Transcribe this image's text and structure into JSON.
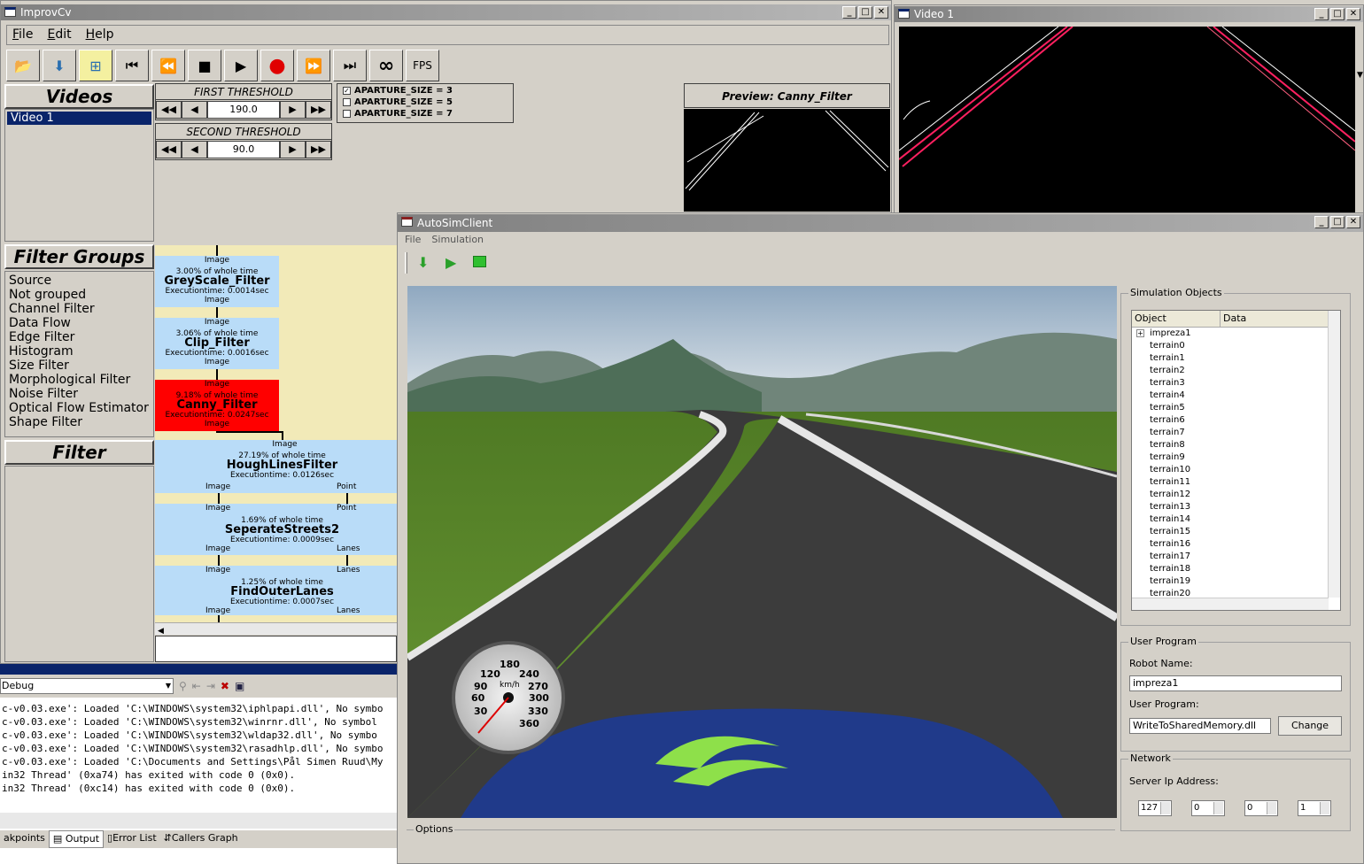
{
  "improvcv": {
    "title": "ImprovCv",
    "menu": [
      "File",
      "Edit",
      "Help"
    ],
    "fps": "FPS"
  },
  "videos": {
    "header": "Videos",
    "items": [
      "Video 1"
    ]
  },
  "filter_groups": {
    "header": "Filter Groups",
    "items": [
      "Source",
      "Not grouped",
      "Channel Filter",
      "Data Flow",
      "Edge Filter",
      "Histogram",
      "Size Filter",
      "Morphological Filter",
      "Noise Filter",
      "Optical Flow Estimator",
      "Shape Filter"
    ]
  },
  "filter": {
    "header": "Filter"
  },
  "thresholds": [
    {
      "title": "FIRST THRESHOLD",
      "value": "190.0"
    },
    {
      "title": "SECOND THRESHOLD",
      "value": "90.0"
    }
  ],
  "aperture": [
    {
      "label": "APARTURE_SIZE = 3",
      "checked": "✓"
    },
    {
      "label": "APARTURE_SIZE = 5",
      "checked": ""
    },
    {
      "label": "APARTURE_SIZE = 7",
      "checked": ""
    }
  ],
  "preview": {
    "title": "Preview: Canny_Filter"
  },
  "filters": [
    {
      "name": "GreyScale_Filter",
      "pct": "3.00% of whole time",
      "exec": "Executiontime: 0.0014sec",
      "in": "Image",
      "out": "Image"
    },
    {
      "name": "Clip_Filter",
      "pct": "3.06% of whole time",
      "exec": "Executiontime: 0.0016sec",
      "in": "Image",
      "out": "Image"
    },
    {
      "name": "Canny_Filter",
      "pct": "9.18% of whole time",
      "exec": "Executiontime: 0.0247sec",
      "in": "Image",
      "out": "Image"
    },
    {
      "name": "HoughLinesFilter",
      "pct": "27.19% of whole time",
      "exec": "Executiontime: 0.0126sec",
      "in": "Image",
      "out": "Image",
      "out2": "Point"
    },
    {
      "name": "SeperateStreets2",
      "pct": "1.69% of whole time",
      "exec": "Executiontime: 0.0009sec",
      "in": "Image",
      "in2": "Point",
      "out": "Image",
      "out2": "Lanes"
    },
    {
      "name": "FindOuterLanes",
      "pct": "1.25% of whole time",
      "exec": "Executiontime: 0.0007sec",
      "in": "Image",
      "in2": "Lanes",
      "out": "Image",
      "out2": "Lanes"
    }
  ],
  "video1": {
    "title": "Video 1"
  },
  "output": {
    "config": "Debug",
    "lines": [
      "c-v0.03.exe': Loaded 'C:\\WINDOWS\\system32\\iphlpapi.dll', No symbo",
      "c-v0.03.exe': Loaded 'C:\\WINDOWS\\system32\\winrnr.dll', No symbol",
      "c-v0.03.exe': Loaded 'C:\\WINDOWS\\system32\\wldap32.dll', No symbo",
      "c-v0.03.exe': Loaded 'C:\\WINDOWS\\system32\\rasadhlp.dll', No symbo",
      "c-v0.03.exe': Loaded 'C:\\Documents and Settings\\Pål Simen Ruud\\My",
      "in32 Thread' (0xa74) has exited with code 0 (0x0).",
      "in32 Thread' (0xc14) has exited with code 0 (0x0)."
    ],
    "tabs": [
      "akpoints",
      "Output",
      "Error List",
      "Callers Graph"
    ]
  },
  "autosim": {
    "title": "AutoSimClient",
    "menu": [
      "File",
      "Simulation"
    ],
    "options": "Options",
    "sim_objects": {
      "title": "Simulation Objects",
      "col1": "Object",
      "col2": "Data",
      "items": [
        "impreza1",
        "terrain0",
        "terrain1",
        "terrain2",
        "terrain3",
        "terrain4",
        "terrain5",
        "terrain6",
        "terrain7",
        "terrain8",
        "terrain9",
        "terrain10",
        "terrain11",
        "terrain12",
        "terrain13",
        "terrain14",
        "terrain15",
        "terrain16",
        "terrain17",
        "terrain18",
        "terrain19",
        "terrain20"
      ]
    },
    "user_program": {
      "title": "User Program",
      "robot_label": "Robot Name:",
      "robot": "impreza1",
      "prog_label": "User Program:",
      "prog": "WriteToSharedMemory.dll",
      "change": "Change"
    },
    "network": {
      "title": "Network",
      "ip_label": "Server Ip Address:",
      "ip": [
        "127",
        "0",
        "0",
        "1"
      ]
    },
    "speedo": {
      "unit": "km/h",
      "ticks": [
        "30",
        "60",
        "90",
        "120",
        "180",
        "240",
        "270",
        "300",
        "330",
        "360"
      ]
    }
  },
  "colors": {
    "active_title": "#0a246a",
    "canny": "#ff0000",
    "filter_bg": "#b9dcf8"
  }
}
